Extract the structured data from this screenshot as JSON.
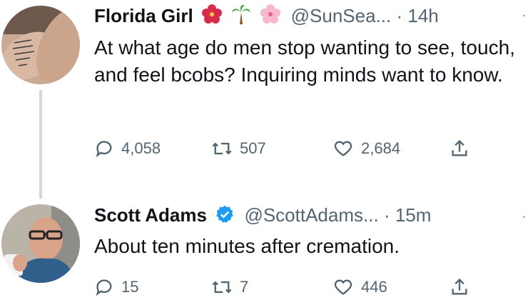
{
  "tweet1": {
    "display_name": "Florida Girl",
    "name_emojis": [
      "hibiscus-emoji",
      "palm-tree-emoji",
      "cherry-blossom-emoji"
    ],
    "handle": "@SunSea...",
    "separator": "·",
    "time": "14h",
    "text": "At what age do men stop wanting to see, touch, and feel bcobs? Inquiring minds want to know.",
    "replies": "4,058",
    "retweets": "507",
    "likes": "2,684"
  },
  "tweet2": {
    "display_name": "Scott Adams",
    "verified_icon": "verified-badge-icon",
    "handle": "@ScottAdams...",
    "separator": "·",
    "time": "15m",
    "text": "About ten minutes after cremation.",
    "replies": "15",
    "retweets": "7",
    "likes": "446"
  },
  "colors": {
    "text": "#0f1419",
    "muted": "#536471",
    "verified": "#1d9bf0",
    "thread_line": "#cfd9de"
  }
}
